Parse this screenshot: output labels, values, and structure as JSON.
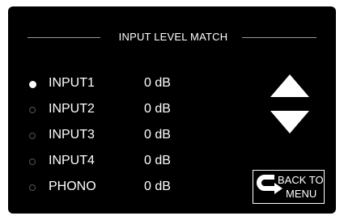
{
  "title": "INPUT LEVEL MATCH",
  "inputs": [
    {
      "label": "INPUT1",
      "value": "0 dB",
      "selected": true
    },
    {
      "label": "INPUT2",
      "value": "0 dB",
      "selected": false
    },
    {
      "label": "INPUT3",
      "value": "0 dB",
      "selected": false
    },
    {
      "label": "INPUT4",
      "value": "0 dB",
      "selected": false
    },
    {
      "label": "PHONO",
      "value": "0 dB",
      "selected": false
    }
  ],
  "back_button": {
    "line1": "BACK TO",
    "line2": "MENU",
    "icon": "return-arrow-icon"
  },
  "arrows": {
    "up_icon": "triangle-up-icon",
    "down_icon": "triangle-down-icon"
  },
  "colors": {
    "background": "#000000",
    "text": "#ffffff",
    "divider": "#9a9a9a",
    "radio_inactive": "#555555"
  }
}
